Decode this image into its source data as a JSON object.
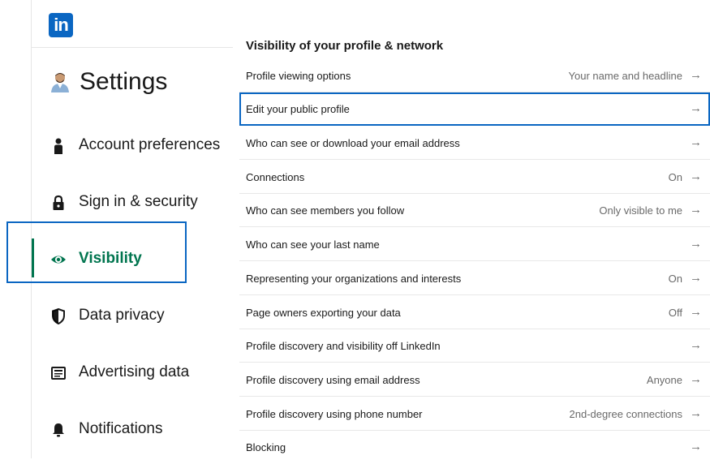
{
  "brand": {
    "logo_text": "in",
    "logo_color": "#0a66c2"
  },
  "sidebar": {
    "title": "Settings",
    "accent_color": "#01754f",
    "items": [
      {
        "label": "Account preferences",
        "icon": "person-icon",
        "active": false
      },
      {
        "label": "Sign in & security",
        "icon": "lock-icon",
        "active": false
      },
      {
        "label": "Visibility",
        "icon": "eye-icon",
        "active": true
      },
      {
        "label": "Data privacy",
        "icon": "shield-icon",
        "active": false
      },
      {
        "label": "Advertising data",
        "icon": "newspaper-icon",
        "active": false
      },
      {
        "label": "Notifications",
        "icon": "bell-icon",
        "active": false
      }
    ]
  },
  "main": {
    "section_title": "Visibility of your profile & network",
    "rows": [
      {
        "label": "Profile viewing options",
        "value": "Your name and headline",
        "arrow": "→"
      },
      {
        "label": "Edit your public profile",
        "value": "",
        "arrow": "→"
      },
      {
        "label": "Who can see or download your email address",
        "value": "",
        "arrow": "→"
      },
      {
        "label": "Connections",
        "value": "On",
        "arrow": "→"
      },
      {
        "label": "Who can see members you follow",
        "value": "Only visible to me",
        "arrow": "→"
      },
      {
        "label": "Who can see your last name",
        "value": "",
        "arrow": "→"
      },
      {
        "label": "Representing your organizations and interests",
        "value": "On",
        "arrow": "→"
      },
      {
        "label": "Page owners exporting your data",
        "value": "Off",
        "arrow": "→"
      },
      {
        "label": "Profile discovery and visibility off LinkedIn",
        "value": "",
        "arrow": "→"
      },
      {
        "label": "Profile discovery using email address",
        "value": "Anyone",
        "arrow": "→"
      },
      {
        "label": "Profile discovery using phone number",
        "value": "2nd-degree connections",
        "arrow": "→"
      },
      {
        "label": "Blocking",
        "value": "",
        "arrow": "→"
      }
    ]
  }
}
